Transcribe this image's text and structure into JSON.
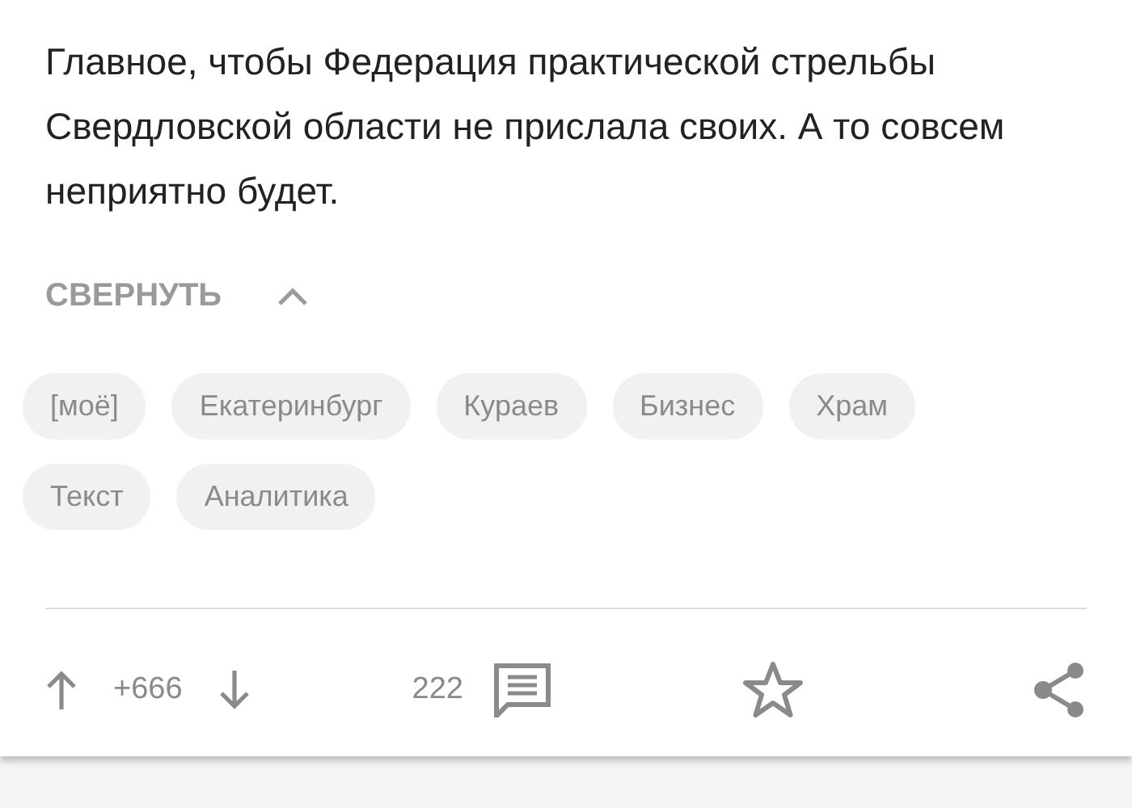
{
  "post": {
    "text": "Главное, чтобы Федерация практической стрельбы Свердловской области не прислала своих. А то совсем неприятно будет.",
    "collapse": {
      "label": "СВЕРНУТЬ",
      "expanded": true
    },
    "tags": [
      "[моё]",
      "Екатеринбург",
      "Кураев",
      "Бизнес",
      "Храм",
      "Текст",
      "Аналитика"
    ],
    "rating": "+666",
    "comments": "222",
    "saved": false
  }
}
